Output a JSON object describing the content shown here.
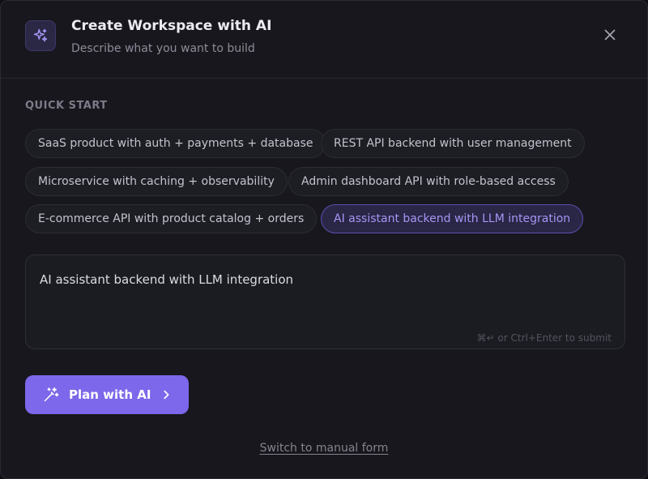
{
  "header": {
    "title": "Create Workspace with AI",
    "subtitle": "Describe what you want to build",
    "icon": "sparkles-icon",
    "close_icon": "close-icon"
  },
  "quick_start": {
    "label": "QUICK START",
    "chips": [
      {
        "label": "SaaS product with auth + payments + database",
        "selected": false
      },
      {
        "label": "REST API backend with user management",
        "selected": false
      },
      {
        "label": "Microservice with caching + observability",
        "selected": false
      },
      {
        "label": "Admin dashboard API with role-based access",
        "selected": false
      },
      {
        "label": "E-commerce API with product catalog + orders",
        "selected": false
      },
      {
        "label": "AI assistant backend with LLM integration",
        "selected": true
      }
    ]
  },
  "prompt": {
    "value": "AI assistant backend with LLM integration",
    "hint": "⌘↵ or Ctrl+Enter to submit"
  },
  "actions": {
    "plan_label": "Plan with AI",
    "plan_icon": "magic-wand-icon",
    "manual_link": "Switch to manual form"
  },
  "colors": {
    "accent": "#7d67ea",
    "accent_text": "#a596f5",
    "background": "#17171d"
  }
}
